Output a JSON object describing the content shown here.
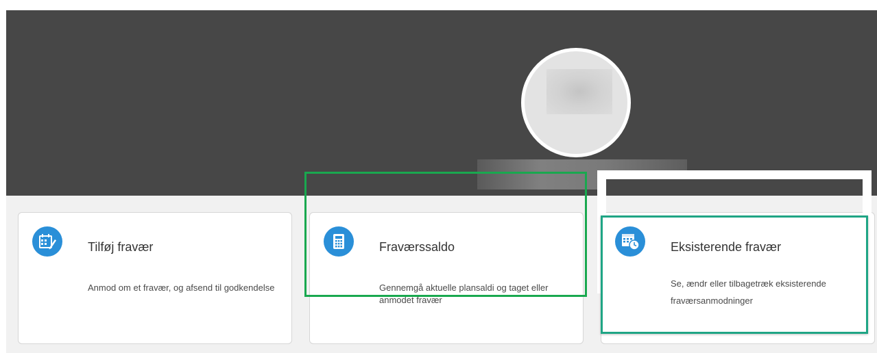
{
  "cards": [
    {
      "title": "Tilføj fravær",
      "description": "Anmod om et fravær, og afsend til godkendelse",
      "icon": "calendar-edit-icon"
    },
    {
      "title": "Fraværssaldo",
      "description": "Gennemgå aktuelle plansaldi og taget eller anmodet fravær",
      "icon": "calculator-icon"
    },
    {
      "title": "Eksisterende fravær",
      "description_partial": "Se, ændr eller tilbagetræk eksisterende",
      "description_line2": "fraværsanmodninger",
      "icon": "calendar-clock-icon"
    }
  ],
  "colors": {
    "hero_background": "#474747",
    "icon_background": "#2a8fd8",
    "highlight_green": "#19a84f",
    "highlight_teal": "#1fa585",
    "strip_background": "#f1f1f1"
  }
}
